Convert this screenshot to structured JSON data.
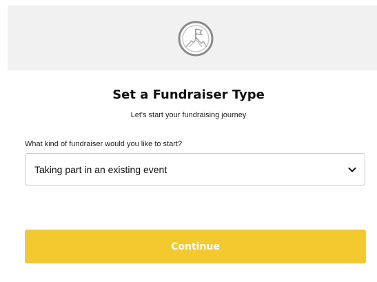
{
  "header": {
    "logo_icon": "flag-mountain-logo-icon"
  },
  "main": {
    "title": "Set a Fundraiser Type",
    "subtitle": "Let's start your fundraising journey"
  },
  "form": {
    "question_label": "What kind of fundraiser would you like to start?",
    "select": {
      "value": "Taking part in an existing event",
      "icon": "chevron-down-icon"
    },
    "continue_label": "Continue"
  },
  "colors": {
    "header_background": "#f1f1f1",
    "continue_background": "#f3c92f",
    "continue_text": "#ffffff"
  }
}
